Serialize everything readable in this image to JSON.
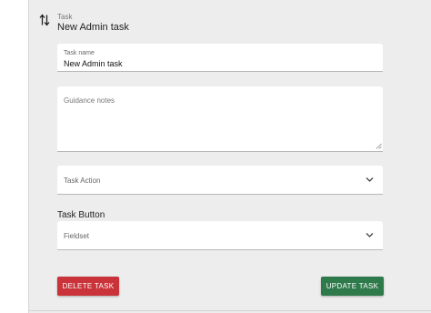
{
  "task": {
    "caption": "Task",
    "title": "New Admin task"
  },
  "fields": {
    "task_name": {
      "label": "Task name",
      "value": "New Admin task"
    },
    "guidance_notes": {
      "placeholder": "Guidance notes",
      "value": ""
    },
    "task_action": {
      "placeholder": "Task Action"
    },
    "task_button_section": "Task Button",
    "fieldset": {
      "placeholder": "Fieldset"
    }
  },
  "buttons": {
    "delete": "DELETE TASK",
    "update": "UPDATE TASK"
  },
  "icons": {
    "reorder": "reorder-arrows-icon",
    "dropdown": "chevron-down-icon",
    "resize": "resize-handle-icon"
  },
  "colors": {
    "panel_bg": "#ededed",
    "delete": "#c93339",
    "update": "#2e7a4a"
  }
}
